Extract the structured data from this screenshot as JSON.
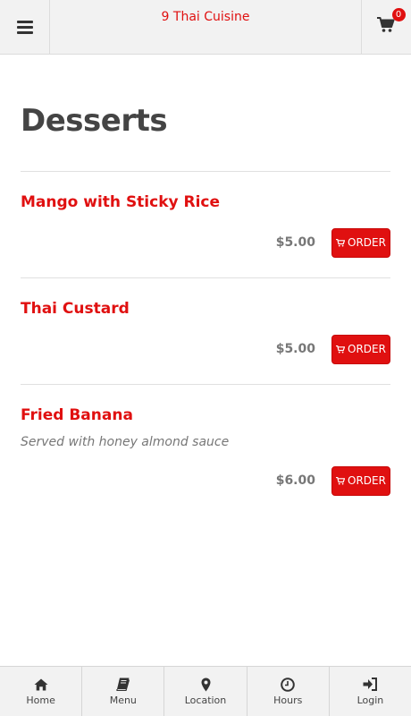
{
  "app": {
    "title": "9 Thai Cuisine"
  },
  "header": {
    "menu_icon": "hamburger-icon",
    "cart_icon": "cart-icon",
    "cart_count": "0"
  },
  "page": {
    "title": "Desserts"
  },
  "order_label": "ORDER",
  "items": [
    {
      "name": "Mango with Sticky Rice",
      "description": "",
      "price": "$5.00"
    },
    {
      "name": "Thai Custard",
      "description": "",
      "price": "$5.00"
    },
    {
      "name": "Fried Banana",
      "description": "Served with honey almond sauce",
      "price": "$6.00"
    }
  ],
  "nav": [
    {
      "label": "Home",
      "icon": "home-icon"
    },
    {
      "label": "Menu",
      "icon": "book-icon"
    },
    {
      "label": "Location",
      "icon": "map-marker-icon"
    },
    {
      "label": "Hours",
      "icon": "clock-icon"
    },
    {
      "label": "Login",
      "icon": "sign-in-icon"
    }
  ],
  "colors": {
    "accent": "#e01010",
    "header_bg": "#f2f2f2",
    "text_muted": "#777777"
  }
}
